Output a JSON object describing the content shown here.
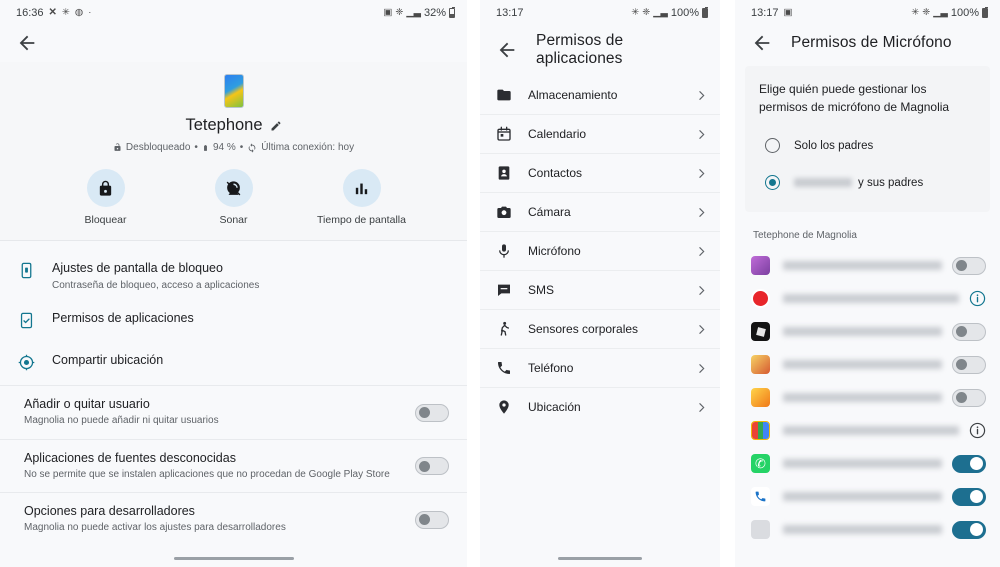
{
  "panel1": {
    "statusbar": {
      "time": "16:36",
      "icons": [
        "x-icon",
        "bluetooth-icon",
        "whatsapp-icon",
        "dot-icon"
      ],
      "battery": "32%"
    },
    "device": {
      "name": "Tetephone",
      "lock_state": "Desbloqueado",
      "battery": "94 %",
      "last_seen": "Última conexión: hoy",
      "separator": "•"
    },
    "actions": [
      {
        "label": "Bloquear",
        "icon": "lock-icon"
      },
      {
        "label": "Sonar",
        "icon": "ring-icon"
      },
      {
        "label": "Tiempo de pantalla",
        "icon": "bar-chart-icon"
      }
    ],
    "settings": [
      {
        "title": "Ajustes de pantalla de bloqueo",
        "subtitle": "Contraseña de bloqueo, acceso a aplicaciones",
        "icon": "lockscreen-icon"
      },
      {
        "title": "Permisos de aplicaciones",
        "subtitle": "",
        "icon": "app-permissions-icon"
      },
      {
        "title": "Compartir ubicación",
        "subtitle": "",
        "icon": "location-share-icon"
      }
    ],
    "toggles": [
      {
        "title": "Añadir o quitar usuario",
        "subtitle": "Magnolia no puede añadir ni quitar usuarios",
        "on": false
      },
      {
        "title": "Aplicaciones de fuentes desconocidas",
        "subtitle": "No se permite que se instalen aplicaciones que no procedan de Google Play Store",
        "on": false
      },
      {
        "title": "Opciones para desarrolladores",
        "subtitle": "Magnolia no puede activar los ajustes para desarrolladores",
        "on": false
      }
    ]
  },
  "panel2": {
    "statusbar": {
      "time": "13:17",
      "battery": "100%"
    },
    "title": "Permisos de aplicaciones",
    "items": [
      {
        "label": "Almacenamiento",
        "icon": "folder-icon"
      },
      {
        "label": "Calendario",
        "icon": "calendar-icon"
      },
      {
        "label": "Contactos",
        "icon": "contacts-icon"
      },
      {
        "label": "Cámara",
        "icon": "camera-icon"
      },
      {
        "label": "Micrófono",
        "icon": "microphone-icon"
      },
      {
        "label": "SMS",
        "icon": "sms-icon"
      },
      {
        "label": "Sensores corporales",
        "icon": "body-sensors-icon"
      },
      {
        "label": "Teléfono",
        "icon": "phone-icon"
      },
      {
        "label": "Ubicación",
        "icon": "location-icon"
      }
    ]
  },
  "panel3": {
    "statusbar": {
      "time": "13:17",
      "battery": "100%"
    },
    "title": "Permisos de Micrófono",
    "prompt": "Elige quién puede gestionar los permisos de micrófono de Magnolia",
    "options": [
      {
        "label": "Solo los padres",
        "selected": false,
        "redacted": false
      },
      {
        "label": "y sus padres",
        "selected": true,
        "redacted": true
      }
    ],
    "section_label": "Tetephone de Magnolia",
    "apps": [
      {
        "icon_color": "#9b59b6",
        "control": "toggle",
        "on": false
      },
      {
        "icon_color": "#e8262b",
        "control": "info"
      },
      {
        "icon_color": "#1c1c1c",
        "control": "toggle",
        "on": false
      },
      {
        "icon_color": "#e8b33c",
        "control": "toggle",
        "on": false
      },
      {
        "icon_color": "#f0a30a",
        "control": "toggle",
        "on": false
      },
      {
        "icon_color": "#f2f2f2",
        "control": "info"
      },
      {
        "icon_color": "#25d366",
        "control": "toggle",
        "on": true
      },
      {
        "icon_color": "#ffffff",
        "control": "toggle",
        "on": true
      },
      {
        "icon_color": "#dadce0",
        "control": "toggle",
        "on": true
      }
    ]
  },
  "colors": {
    "accent": "#12768f",
    "toggle_on": "#1d6f90",
    "action_circle": "#d9e9f5"
  }
}
